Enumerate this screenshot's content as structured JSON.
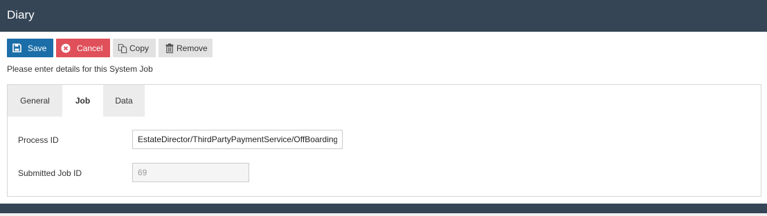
{
  "header": {
    "title": "Diary"
  },
  "toolbar": {
    "save_label": "Save",
    "cancel_label": "Cancel",
    "copy_label": "Copy",
    "remove_label": "Remove",
    "icons": {
      "save": "floppy-disk-icon",
      "cancel": "close-circle-icon",
      "copy": "copy-icon",
      "remove": "trash-icon"
    },
    "colors": {
      "save": "#1b6ea7",
      "cancel": "#e0505a",
      "neutral": "#e2e2e2"
    }
  },
  "instructions": "Please enter details for this System Job",
  "tabs": [
    {
      "label": "General",
      "active": false
    },
    {
      "label": "Job",
      "active": true
    },
    {
      "label": "Data",
      "active": false
    }
  ],
  "form": {
    "process_id": {
      "label": "Process ID",
      "value": "EstateDirector/ThirdPartyPaymentService/OffBoarding"
    },
    "submitted_job_id": {
      "label": "Submitted Job ID",
      "value": "69",
      "disabled": true
    }
  },
  "theme": {
    "header_bg": "#354556"
  }
}
